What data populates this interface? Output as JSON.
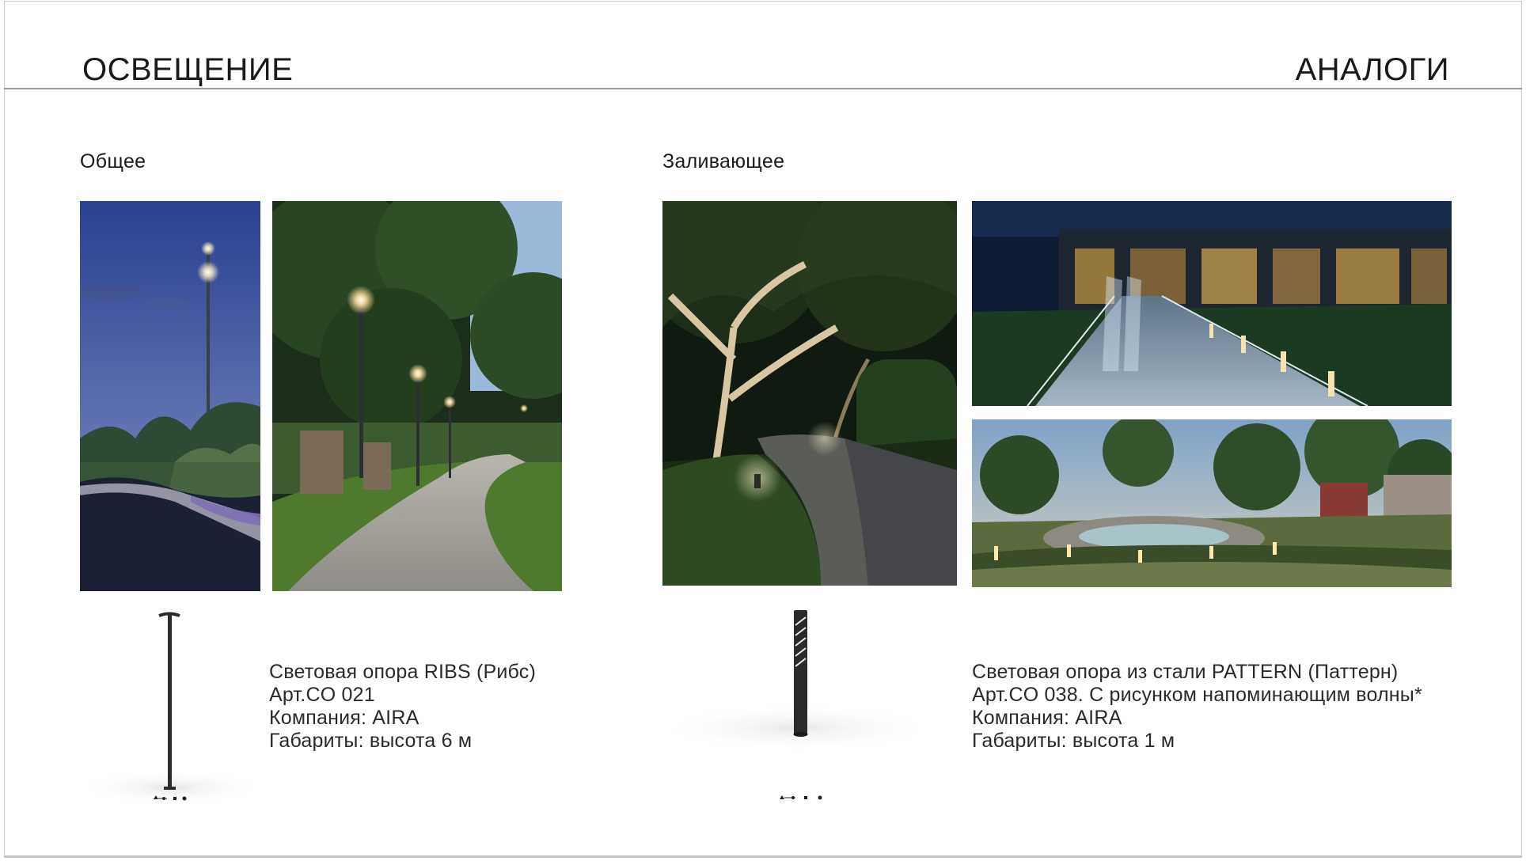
{
  "header": {
    "title": "ОСВЕЩЕНИЕ",
    "right_title": "АНАЛОГИ"
  },
  "sections": {
    "general": {
      "label": "Общее",
      "product": {
        "line1": "Световая опора RIBS (Рибс)",
        "line2": "Арт.CO 021",
        "line3": "Компания: AIRA",
        "line4": "Габариты: высота 6 м"
      }
    },
    "flood": {
      "label": "Заливающее",
      "product": {
        "line1": "Световая опора из стали PATTERN (Паттерн)",
        "line2": "Арт.CO 038. С рисунком напоминающим волны*",
        "line3": "Компания: AIRA",
        "line4": "Габариты: высота 1 м"
      }
    }
  },
  "colors": {
    "text": "#1a1a1a",
    "divider": "#9a9a9a",
    "night_sky": "#2c3f86",
    "lamp_glow": "#ffd98a",
    "foliage": "#1f3a18"
  }
}
